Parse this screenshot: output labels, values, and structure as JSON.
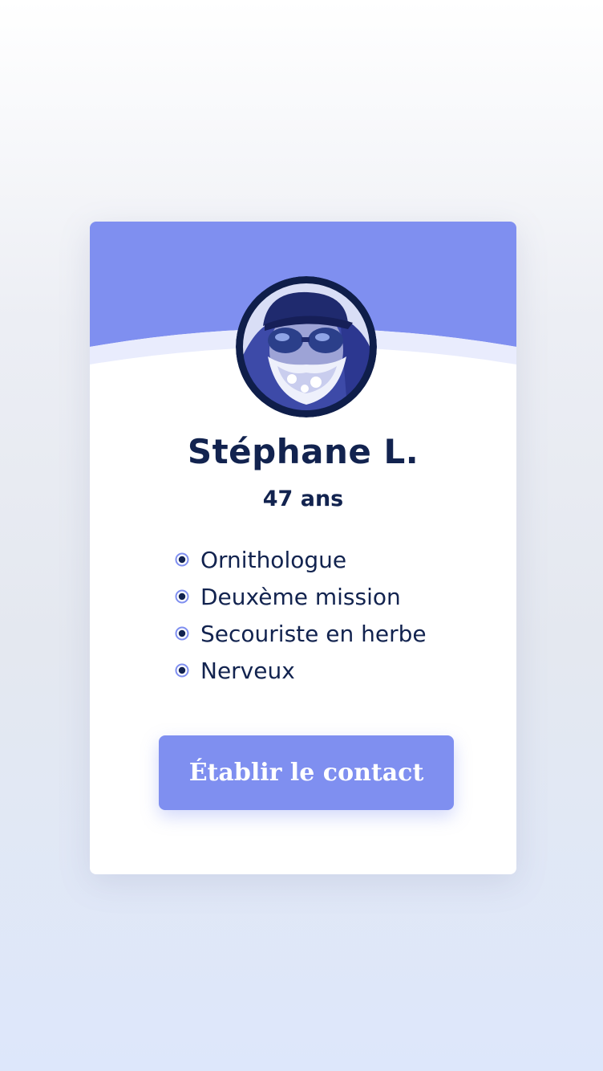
{
  "profile": {
    "name": "Stéphane L.",
    "age": "47 ans",
    "traits": [
      "Ornithologue",
      "Deuxème mission",
      "Secouriste en herbe",
      "Nerveux"
    ],
    "photo": {
      "icon": "profile-photo"
    }
  },
  "actions": {
    "contact_label": "Établir le contact"
  },
  "colors": {
    "accent": "#7f8ff0",
    "text": "#12234f",
    "card": "#ffffff",
    "avatar_border": "#0f1e4a"
  }
}
